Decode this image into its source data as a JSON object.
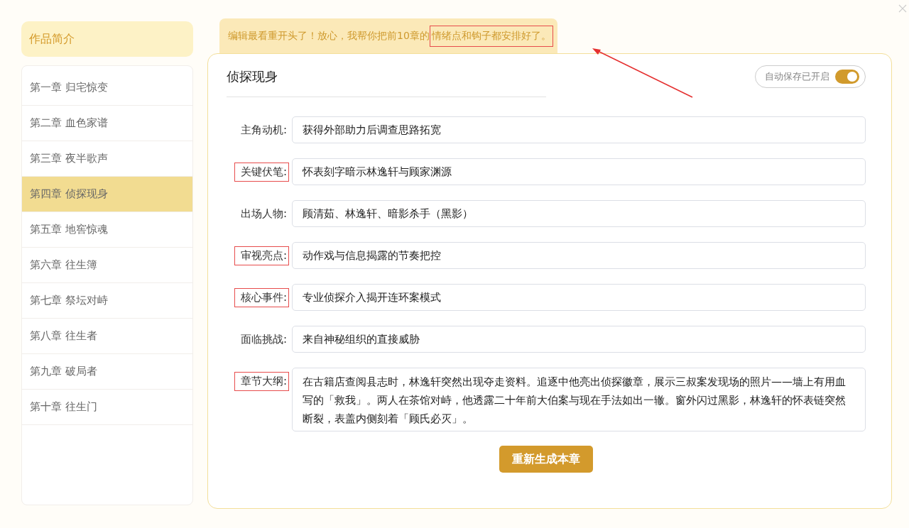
{
  "sidebar": {
    "intro": "作品简介",
    "chapters": [
      {
        "label": "第一章 归宅惊变",
        "selected": false
      },
      {
        "label": "第二章 血色家谱",
        "selected": false
      },
      {
        "label": "第三章 夜半歌声",
        "selected": false
      },
      {
        "label": "第四章 侦探现身",
        "selected": true
      },
      {
        "label": "第五章 地窖惊魂",
        "selected": false
      },
      {
        "label": "第六章 往生簿",
        "selected": false
      },
      {
        "label": "第七章 祭坛对峙",
        "selected": false
      },
      {
        "label": "第八章 往生者",
        "selected": false
      },
      {
        "label": "第九章 破局者",
        "selected": false
      },
      {
        "label": "第十章 往生门",
        "selected": false
      }
    ]
  },
  "banner": {
    "text": "编辑最看重开头了！放心，我帮你把前10章的",
    "highlighted_text": "情绪点和钩子都安排好了。"
  },
  "editor": {
    "title": "侦探现身",
    "autosave": {
      "label": "自动保存已开启",
      "on": true
    },
    "fields": [
      {
        "label": "主角动机:",
        "value": "获得外部助力后调查思路拓宽",
        "annotated": false,
        "kind": "input"
      },
      {
        "label": "关键伏笔:",
        "value": "怀表刻字暗示林逸轩与顾家渊源",
        "annotated": true,
        "kind": "input"
      },
      {
        "label": "出场人物:",
        "value": "顾清茹、林逸轩、暗影杀手（黑影）",
        "annotated": false,
        "kind": "input"
      },
      {
        "label": "审视亮点:",
        "value": "动作戏与信息揭露的节奏把控",
        "annotated": true,
        "kind": "input"
      },
      {
        "label": "核心事件:",
        "value": "专业侦探介入揭开连环案模式",
        "annotated": true,
        "kind": "input"
      },
      {
        "label": "面临挑战:",
        "value": "来自神秘组织的直接威胁",
        "annotated": false,
        "kind": "input"
      },
      {
        "label": "章节大纲:",
        "value": "在古籍店查阅县志时，林逸轩突然出现夺走资料。追逐中他亮出侦探徽章，展示三叔案发现场的照片——墙上有用血写的「救我」。两人在茶馆对峙，他透露二十年前大伯案与现在手法如出一辙。窗外闪过黑影，林逸轩的怀表链突然断裂，表盖内侧刻着「顾氏必灭」。",
        "annotated": true,
        "kind": "textarea"
      }
    ],
    "button": "重新生成本章"
  }
}
